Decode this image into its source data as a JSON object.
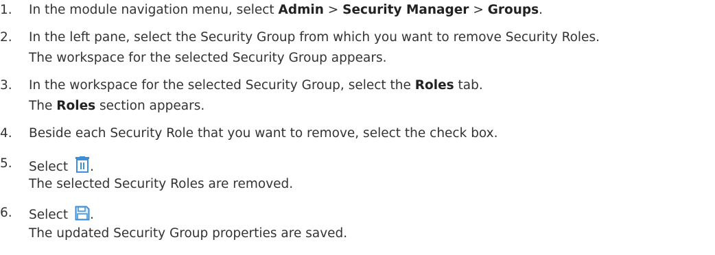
{
  "steps": [
    {
      "number": "1.",
      "parts": [
        "In the module navigation menu, select ",
        "Admin",
        " > ",
        "Security Manager",
        " > ",
        "Groups",
        "."
      ]
    },
    {
      "number": "2.",
      "line1": "In the left pane, select the Security Group from which you want to remove Security Roles.",
      "line2": "The workspace for the selected Security Group appears."
    },
    {
      "number": "3.",
      "line1_pre": "In the workspace for the selected Security Group, select the ",
      "line1_bold": "Roles",
      "line1_post": " tab.",
      "line2_pre": "The ",
      "line2_bold": "Roles",
      "line2_post": " section appears."
    },
    {
      "number": "4.",
      "line1": "Beside each Security Role that you want to remove, select the check box."
    },
    {
      "number": "5.",
      "line1_pre": "Select ",
      "icon": "trash-icon",
      "line1_post": ".",
      "line2": "The selected Security Roles are removed."
    },
    {
      "number": "6.",
      "line1_pre": "Select ",
      "icon": "save-icon",
      "line1_post": ".",
      "line2": "The updated Security Group properties are saved."
    }
  ],
  "colors": {
    "text": "#333333",
    "icon": "#3b8fd9"
  }
}
